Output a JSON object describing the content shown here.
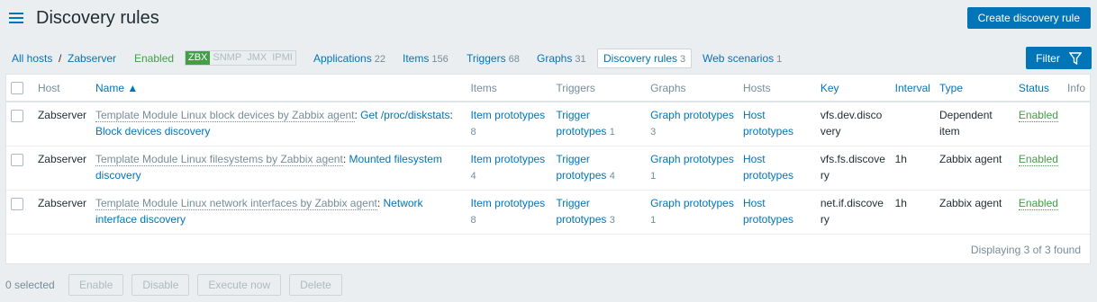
{
  "header": {
    "title": "Discovery rules",
    "create_button": "Create discovery rule"
  },
  "nav": {
    "all_hosts": "All hosts",
    "separator": "/",
    "host": "Zabserver",
    "status": "Enabled",
    "availability": [
      "ZBX",
      "SNMP",
      "JMX",
      "IPMI"
    ],
    "tabs": [
      {
        "label": "Applications",
        "count": "22"
      },
      {
        "label": "Items",
        "count": "156"
      },
      {
        "label": "Triggers",
        "count": "68"
      },
      {
        "label": "Graphs",
        "count": "31"
      },
      {
        "label": "Discovery rules",
        "count": "3"
      },
      {
        "label": "Web scenarios",
        "count": "1"
      }
    ],
    "filter": "Filter"
  },
  "table": {
    "columns": [
      "Host",
      "Name ▲",
      "Items",
      "Triggers",
      "Graphs",
      "Hosts",
      "Key",
      "Interval",
      "Type",
      "Status",
      "Info"
    ],
    "rows": [
      {
        "host": "Zabserver",
        "template": "Template Module Linux block devices by Zabbix agent",
        "parent": "Get /proc/diskstats",
        "name": "Block devices discovery",
        "items": "Item prototypes",
        "items_count": "8",
        "triggers": "Trigger prototypes",
        "triggers_count": "1",
        "graphs": "Graph prototypes",
        "graphs_count": "3",
        "hosts": "Host prototypes",
        "key": "vfs.dev.discovery",
        "interval": "",
        "type": "Dependent item",
        "status": "Enabled"
      },
      {
        "host": "Zabserver",
        "template": "Template Module Linux filesystems by Zabbix agent",
        "parent": "",
        "name": "Mounted filesystem discovery",
        "items": "Item prototypes",
        "items_count": "4",
        "triggers": "Trigger prototypes",
        "triggers_count": "4",
        "graphs": "Graph prototypes",
        "graphs_count": "1",
        "hosts": "Host prototypes",
        "key": "vfs.fs.discovery",
        "interval": "1h",
        "type": "Zabbix agent",
        "status": "Enabled"
      },
      {
        "host": "Zabserver",
        "template": "Template Module Linux network interfaces by Zabbix agent",
        "parent": "",
        "name": "Network interface discovery",
        "items": "Item prototypes",
        "items_count": "8",
        "triggers": "Trigger prototypes",
        "triggers_count": "3",
        "graphs": "Graph prototypes",
        "graphs_count": "1",
        "hosts": "Host prototypes",
        "key": "net.if.discovery",
        "interval": "1h",
        "type": "Zabbix agent",
        "status": "Enabled"
      }
    ],
    "footer": "Displaying 3 of 3 found"
  },
  "actions": {
    "selected": "0 selected",
    "buttons": [
      "Enable",
      "Disable",
      "Execute now",
      "Delete"
    ]
  }
}
